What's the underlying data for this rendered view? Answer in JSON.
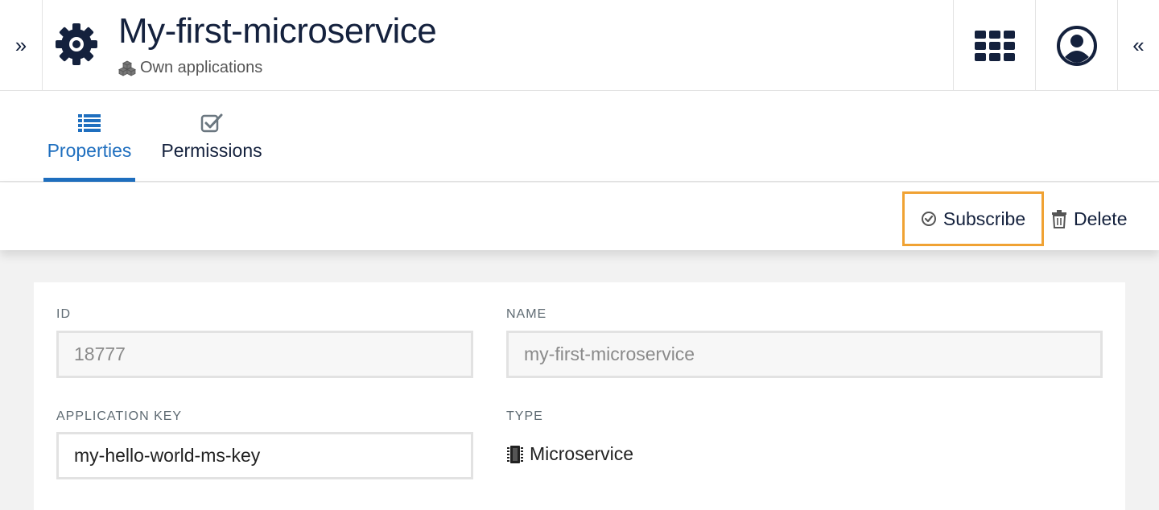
{
  "header": {
    "title": "My-first-microservice",
    "subtitle": "Own applications",
    "icon": "gear-icon",
    "left_toggle": "»",
    "right_toggle": "«"
  },
  "tabs": [
    {
      "label": "Properties",
      "icon": "list-icon",
      "active": true
    },
    {
      "label": "Permissions",
      "icon": "checkbox-icon",
      "active": false
    }
  ],
  "actions": {
    "subscribe_label": "Subscribe",
    "delete_label": "Delete"
  },
  "form": {
    "id_label": "ID",
    "id_value": "18777",
    "name_label": "NAME",
    "name_value": "my-first-microservice",
    "key_label": "APPLICATION KEY",
    "key_value": "my-hello-world-ms-key",
    "type_label": "TYPE",
    "type_value": "Microservice"
  },
  "colors": {
    "accent": "#1f6fbf",
    "highlight": "#f0a233",
    "text": "#14213d"
  }
}
